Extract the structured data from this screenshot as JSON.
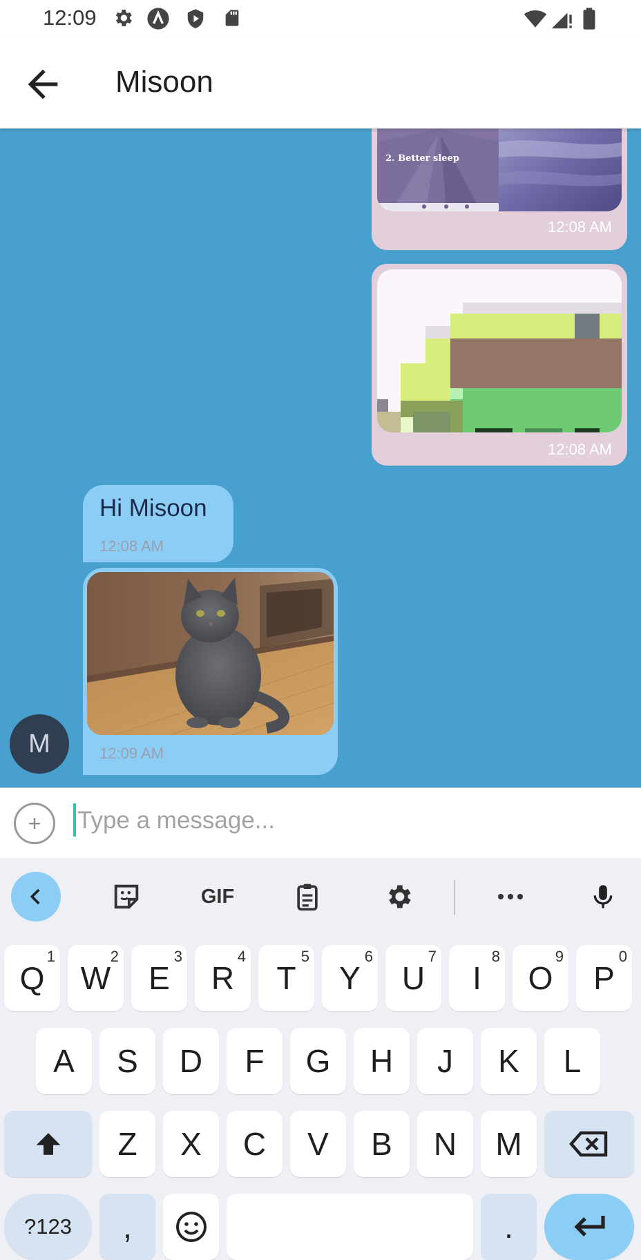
{
  "status_bar": {
    "time": "12:09",
    "icons_left": [
      "settings-icon",
      "a-icon",
      "shield-icon",
      "sd-card-icon"
    ],
    "icons_right": [
      "wifi-icon",
      "signal-icon",
      "battery-icon"
    ]
  },
  "app_bar": {
    "title": "Misoon",
    "back_icon": "arrow-back-icon"
  },
  "messages": [
    {
      "direction": "outgoing",
      "type": "image",
      "caption_in_image": "2. Better sleep",
      "time": "12:08 AM"
    },
    {
      "direction": "outgoing",
      "type": "image",
      "time": "12:08 AM"
    },
    {
      "direction": "incoming",
      "type": "text",
      "text": "Hi Misoon",
      "time": "12:08 AM"
    },
    {
      "direction": "incoming",
      "type": "image",
      "time": "12:09 AM"
    }
  ],
  "avatar": {
    "initial": "M"
  },
  "composer": {
    "placeholder": "Type a message...",
    "add_icon": "plus-circle-icon"
  },
  "keyboard": {
    "toolbar": [
      "chevron-left-icon",
      "sticker-icon",
      "GIF",
      "clipboard-icon",
      "gear-icon",
      "more-icon",
      "mic-icon"
    ],
    "row1": [
      [
        "Q",
        "1"
      ],
      [
        "W",
        "2"
      ],
      [
        "E",
        "3"
      ],
      [
        "R",
        "4"
      ],
      [
        "T",
        "5"
      ],
      [
        "Y",
        "6"
      ],
      [
        "U",
        "7"
      ],
      [
        "I",
        "8"
      ],
      [
        "O",
        "9"
      ],
      [
        "P",
        "0"
      ]
    ],
    "row2": [
      "A",
      "S",
      "D",
      "F",
      "G",
      "H",
      "J",
      "K",
      "L"
    ],
    "row3": [
      "Z",
      "X",
      "C",
      "V",
      "B",
      "N",
      "M"
    ],
    "symbols_label": "?123",
    "comma": ",",
    "period": "."
  },
  "colors": {
    "chat_background": "#48a0cf",
    "outgoing_bubble": "#e2cfda",
    "incoming_bubble": "#8ccdf6",
    "accent": "#35c2b0"
  }
}
